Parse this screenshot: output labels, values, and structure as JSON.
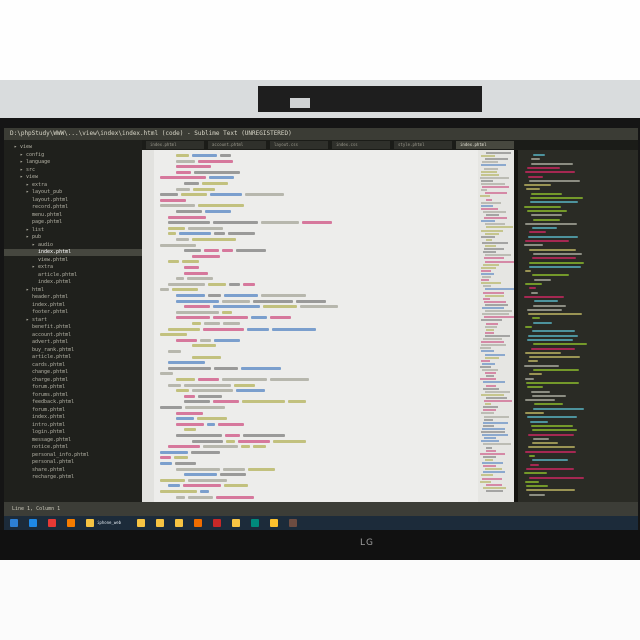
{
  "window": {
    "title": "D:\\phpStudy\\WWW\\...\\view\\index\\index.html (code) - Sublime Text (UNREGISTERED)"
  },
  "sidebar": {
    "items": [
      {
        "label": "view",
        "indent": 0,
        "active": false
      },
      {
        "label": "config",
        "indent": 1,
        "active": false
      },
      {
        "label": "language",
        "indent": 1,
        "active": false
      },
      {
        "label": "src",
        "indent": 1,
        "active": false
      },
      {
        "label": "view",
        "indent": 1,
        "active": false
      },
      {
        "label": "extra",
        "indent": 2,
        "active": false
      },
      {
        "label": "layout_pub",
        "indent": 2,
        "active": false
      },
      {
        "label": "layout.phtml",
        "indent": 3,
        "active": false
      },
      {
        "label": "record.phtml",
        "indent": 3,
        "active": false
      },
      {
        "label": "menu.phtml",
        "indent": 3,
        "active": false
      },
      {
        "label": "page.phtml",
        "indent": 3,
        "active": false
      },
      {
        "label": "list",
        "indent": 2,
        "active": false
      },
      {
        "label": "pub",
        "indent": 2,
        "active": false
      },
      {
        "label": "audio",
        "indent": 3,
        "active": false
      },
      {
        "label": "index.phtml",
        "indent": 4,
        "active": true
      },
      {
        "label": "view.phtml",
        "indent": 4,
        "active": false
      },
      {
        "label": "extra",
        "indent": 3,
        "active": false
      },
      {
        "label": "article.phtml",
        "indent": 4,
        "active": false
      },
      {
        "label": "index.phtml",
        "indent": 4,
        "active": false
      },
      {
        "label": "html",
        "indent": 2,
        "active": false
      },
      {
        "label": "header.phtml",
        "indent": 3,
        "active": false
      },
      {
        "label": "index.phtml",
        "indent": 3,
        "active": false
      },
      {
        "label": "footer.phtml",
        "indent": 3,
        "active": false
      },
      {
        "label": "start",
        "indent": 2,
        "active": false
      },
      {
        "label": "benefit.phtml",
        "indent": 3,
        "active": false
      },
      {
        "label": "account.phtml",
        "indent": 3,
        "active": false
      },
      {
        "label": "advert.phtml",
        "indent": 3,
        "active": false
      },
      {
        "label": "buy_rank.phtml",
        "indent": 3,
        "active": false
      },
      {
        "label": "article.phtml",
        "indent": 3,
        "active": false
      },
      {
        "label": "cards.phtml",
        "indent": 3,
        "active": false
      },
      {
        "label": "change.phtml",
        "indent": 3,
        "active": false
      },
      {
        "label": "charge.phtml",
        "indent": 3,
        "active": false
      },
      {
        "label": "forum.phtml",
        "indent": 3,
        "active": false
      },
      {
        "label": "forums.phtml",
        "indent": 3,
        "active": false
      },
      {
        "label": "feedback.phtml",
        "indent": 3,
        "active": false
      },
      {
        "label": "forum.phtml",
        "indent": 3,
        "active": false
      },
      {
        "label": "index.phtml",
        "indent": 3,
        "active": false
      },
      {
        "label": "intro.phtml",
        "indent": 3,
        "active": false
      },
      {
        "label": "login.phtml",
        "indent": 3,
        "active": false
      },
      {
        "label": "message.phtml",
        "indent": 3,
        "active": false
      },
      {
        "label": "notice.phtml",
        "indent": 3,
        "active": false
      },
      {
        "label": "personal_info.phtml",
        "indent": 3,
        "active": false
      },
      {
        "label": "personal.phtml",
        "indent": 3,
        "active": false
      },
      {
        "label": "share.phtml",
        "indent": 3,
        "active": false
      },
      {
        "label": "recharge.phtml",
        "indent": 3,
        "active": false
      }
    ]
  },
  "tabs": [
    {
      "label": "index.phtml",
      "active": false
    },
    {
      "label": "account.phtml",
      "active": false
    },
    {
      "label": "layout.css",
      "active": false
    },
    {
      "label": "index.css",
      "active": false
    },
    {
      "label": "style.phtml",
      "active": false
    },
    {
      "label": "index.phtml",
      "active": true
    }
  ],
  "statusbar": {
    "text": "Line 1, Column 1"
  },
  "taskbar": {
    "items": [
      {
        "icon": "start-icon",
        "label": "",
        "color": "#2d7fd3"
      },
      {
        "icon": "browser-icon",
        "label": "",
        "color": "#1e88e5"
      },
      {
        "icon": "app-icon",
        "label": "",
        "color": "#e53935"
      },
      {
        "icon": "sublime-icon",
        "label": "",
        "color": "#f57c00"
      },
      {
        "icon": "folder-icon",
        "label": "iphone_web",
        "color": "#f6c343"
      },
      {
        "icon": "folder-icon",
        "label": "",
        "color": "#f6c343"
      },
      {
        "icon": "folder-icon",
        "label": "",
        "color": "#f6c343"
      },
      {
        "icon": "folder-icon",
        "label": "",
        "color": "#f6c343"
      },
      {
        "icon": "app-icon",
        "label": "",
        "color": "#ef6c00"
      },
      {
        "icon": "app-icon",
        "label": "",
        "color": "#c62828"
      },
      {
        "icon": "folder-icon",
        "label": "",
        "color": "#f6c343"
      },
      {
        "icon": "app-icon",
        "label": "",
        "color": "#00897b"
      },
      {
        "icon": "app-icon",
        "label": "",
        "color": "#fbc02d"
      },
      {
        "icon": "app-icon",
        "label": "",
        "color": "#6d4c41"
      }
    ]
  },
  "monitor": {
    "brand": "LG"
  },
  "colors": {
    "editor_bg": "#ededeb",
    "keyword": "#c2185b",
    "string": "#9e9d24",
    "tag": "#1e5fb4",
    "comment": "#8a8a7a"
  }
}
